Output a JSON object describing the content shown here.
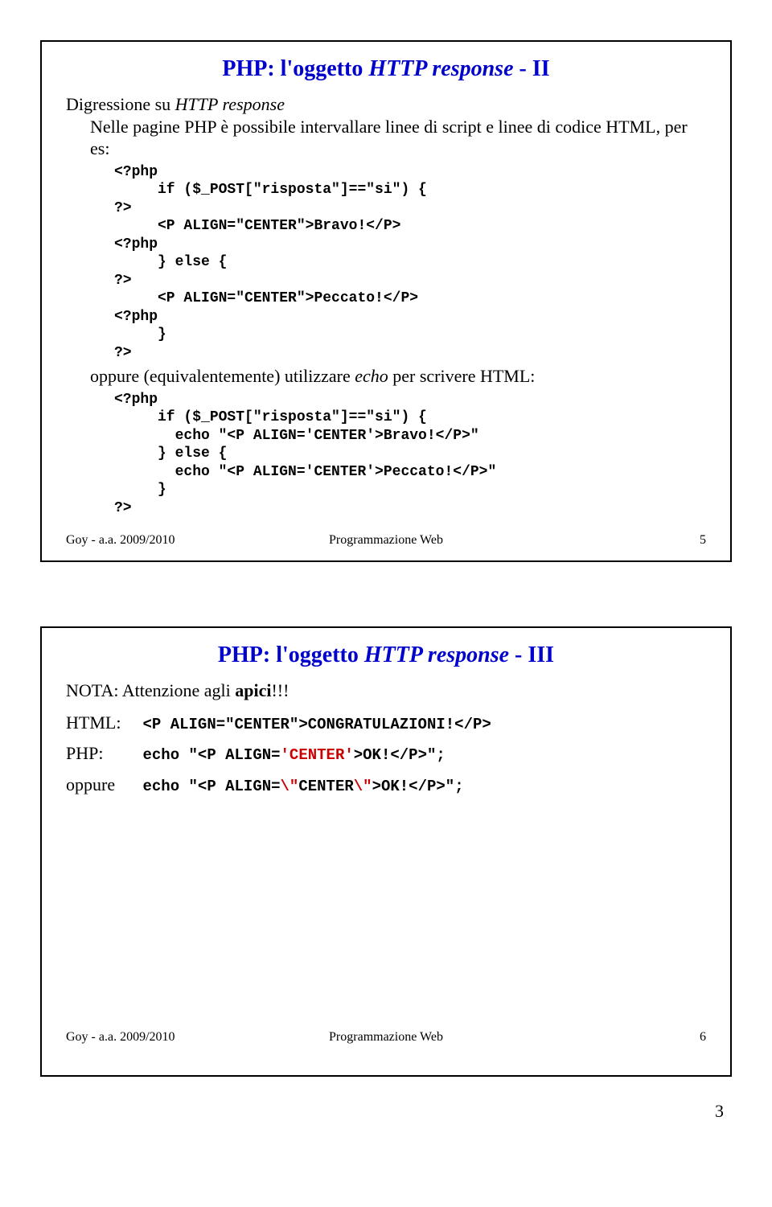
{
  "slide1": {
    "title_prefix": "PHP: l'oggetto ",
    "title_ital": "HTTP response",
    "title_suffix": " - II",
    "line1a": "Digressione su ",
    "line1b": "HTTP response",
    "line2": "Nelle pagine PHP è possibile intervallare linee di script e linee di codice HTML, per es:",
    "code1": "<?php\n     if ($_POST[\"risposta\"]==\"si\") {\n?>\n     <P ALIGN=\"CENTER\">Bravo!</P>\n<?php\n     } else {\n?>\n     <P ALIGN=\"CENTER\">Peccato!</P>\n<?php\n     }\n?>",
    "line3a": "oppure (equivalentemente) utilizzare ",
    "line3b": "echo",
    "line3c": " per scrivere HTML:",
    "code2": "<?php\n     if ($_POST[\"risposta\"]==\"si\") {\n       echo \"<P ALIGN='CENTER'>Bravo!</P>\"\n     } else {\n       echo \"<P ALIGN='CENTER'>Peccato!</P>\"\n     }\n?>",
    "footer_left": "Goy - a.a. 2009/2010",
    "footer_center": "Programmazione Web",
    "footer_right": "5"
  },
  "slide2": {
    "title_prefix": "PHP: l'oggetto ",
    "title_ital": "HTTP response",
    "title_suffix": " - III",
    "nota": "NOTA: Attenzione agli ",
    "nota_bold": "apici",
    "nota_end": "!!!",
    "html_label": "HTML:",
    "html_code": "<P ALIGN=\"CENTER\">CONGRATULAZIONI!</P>",
    "php_label": "PHP:",
    "php_code_pre": "echo \"<P ALIGN=",
    "php_code_mid": "'CENTER'",
    "php_code_post": ">OK!</P>\";",
    "opp_label": "oppure",
    "opp_code_pre": "echo \"<P ALIGN=",
    "opp_code_q1": "\\\"",
    "opp_code_mid": "CENTER",
    "opp_code_q2": "\\\"",
    "opp_code_post": ">OK!</P>\";",
    "footer_left": "Goy - a.a. 2009/2010",
    "footer_center": "Programmazione Web",
    "footer_right": "6"
  },
  "page_number": "3"
}
